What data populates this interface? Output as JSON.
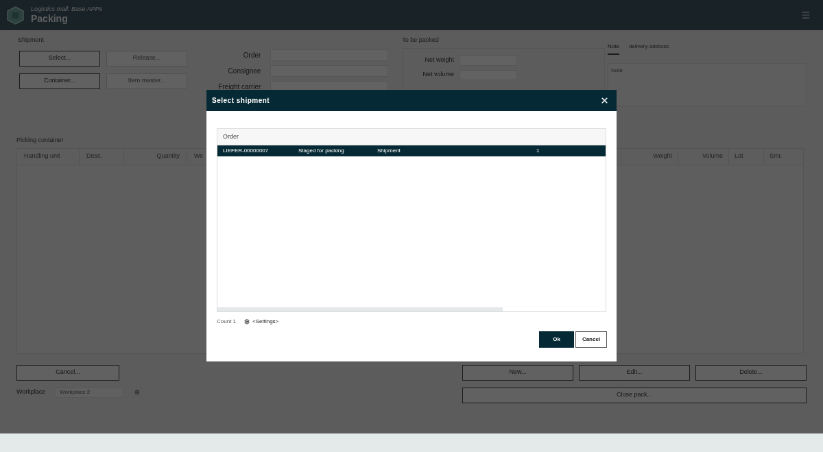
{
  "app": {
    "subtitle": "Logistics mall: Base APPs",
    "title": "Packing"
  },
  "shipment": {
    "label": "Shipment",
    "buttons": [
      {
        "label": "Select...",
        "disabled": false
      },
      {
        "label": "Release...",
        "disabled": true
      },
      {
        "label": "Container...",
        "disabled": false
      },
      {
        "label": "Item master...",
        "disabled": true
      }
    ],
    "fields": [
      {
        "label": "Order"
      },
      {
        "label": "Consignee"
      },
      {
        "label": "Freight carrier"
      }
    ]
  },
  "to_be_packed": {
    "label": "To be packed",
    "fields": [
      {
        "label": "Net weight"
      },
      {
        "label": "Net volume"
      }
    ]
  },
  "tabs": [
    {
      "label": "Note",
      "selected": true
    },
    {
      "label": "delivery address",
      "selected": false
    }
  ],
  "note": {
    "placeholder": "Note"
  },
  "picking_container": {
    "label": "Picking container",
    "columns_left": [
      "Handling unit",
      "Desc.",
      "Quantity",
      "We"
    ],
    "columns_right": [
      "Weight",
      "Volume",
      "Lot",
      "Smr."
    ]
  },
  "bottom": {
    "cancel": "Cancel...",
    "workplace_label": "Workplace",
    "workplace_value": "Workplace 2",
    "actions": [
      "New...",
      "Edit...",
      "Delete..."
    ],
    "close": "Close pack..."
  },
  "dialog": {
    "title": "Select shipment",
    "grid_header": "Order",
    "rows": [
      {
        "cells": [
          "LIEFER-00000007",
          "Staged for packing",
          "Shipment",
          "1"
        ],
        "selected": true
      }
    ],
    "count": "Count 1",
    "settings": "<Settings>",
    "buttons": [
      {
        "label": "Ok",
        "kind": "primary"
      },
      {
        "label": "Cancel",
        "kind": "secondary"
      }
    ]
  }
}
